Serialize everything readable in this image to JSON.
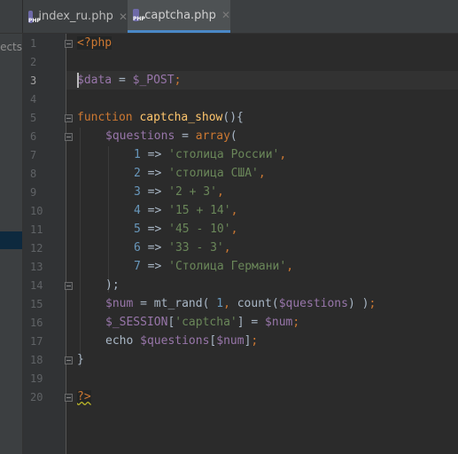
{
  "tabs": [
    {
      "label": "index_ru.php",
      "active": false
    },
    {
      "label": "captcha.php",
      "active": true
    }
  ],
  "project_panel": {
    "label": "ects'"
  },
  "editor": {
    "current_line": 3,
    "line_numbers": [
      "1",
      "2",
      "3",
      "4",
      "5",
      "6",
      "7",
      "8",
      "9",
      "10",
      "11",
      "12",
      "13",
      "14",
      "15",
      "16",
      "17",
      "18",
      "19",
      "20"
    ],
    "code": {
      "l1": "<?php",
      "l3_var": "$data",
      "l3_eq": " = ",
      "l3_post": "$_POST",
      "l3_semi": ";",
      "l5_kw": "function",
      "l5_fn": "captcha_show",
      "l5_rest": "(){",
      "l6_var": "$questions",
      "l6_eq": " = ",
      "l6_kw": "array",
      "l6_paren": "(",
      "items": [
        {
          "key": "1",
          "value": "'столица России'",
          "comma": ","
        },
        {
          "key": "2",
          "value": "'столица США'",
          "comma": ","
        },
        {
          "key": "3",
          "value": "'2 + 3'",
          "comma": ","
        },
        {
          "key": "4",
          "value": "'15 + 14'",
          "comma": ","
        },
        {
          "key": "5",
          "value": "'45 - 10'",
          "comma": ","
        },
        {
          "key": "6",
          "value": "'33 - 3'",
          "comma": ","
        },
        {
          "key": "7",
          "value": "'Столица Германи'",
          "comma": ","
        }
      ],
      "arrow": " => ",
      "l14": ");",
      "l15_var": "$num",
      "l15_eq": " = mt_rand( ",
      "l15_num": "1",
      "l15_comma": ", ",
      "l15_count": "count(",
      "l15_qvar": "$questions",
      "l15_close": ") )",
      "l15_semi": ";",
      "l16_var": "$_SESSION",
      "l16_open": "[",
      "l16_str": "'captcha'",
      "l16_close": "] = ",
      "l16_num": "$num",
      "l16_semi": ";",
      "l17_kw": "echo ",
      "l17_var": "$questions",
      "l17_open": "[",
      "l17_num": "$num",
      "l17_close": "]",
      "l17_semi": ";",
      "l18": "}",
      "l20": "?>"
    }
  },
  "colors": {
    "background": "#2b2b2b",
    "keyword": "#cc7832",
    "variable": "#9876aa",
    "string": "#6a8759",
    "number": "#6897bb",
    "function": "#ffc66d",
    "text": "#a9b7c6"
  }
}
